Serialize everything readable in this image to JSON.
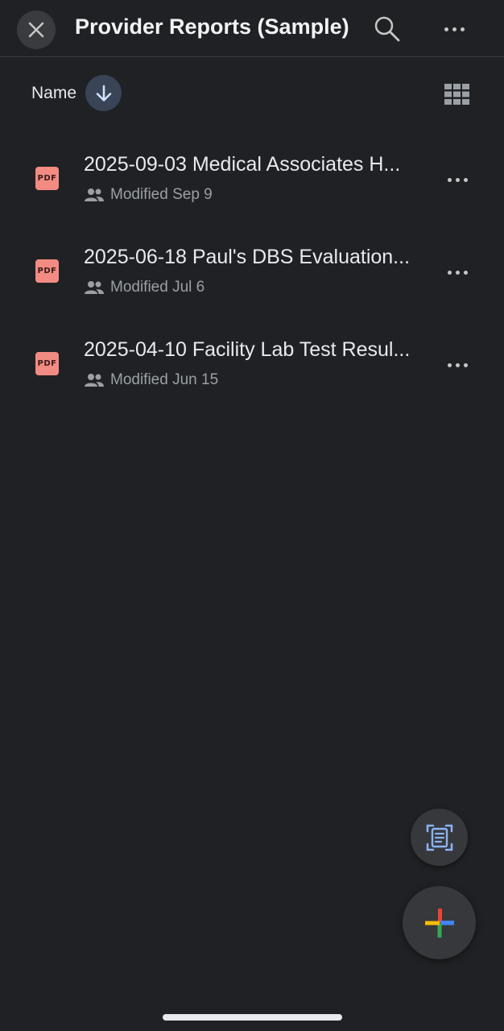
{
  "header": {
    "title": "Provider Reports (Sample)",
    "close_icon": "close-icon",
    "search_icon": "search-icon",
    "more_icon": "more-horizontal-icon"
  },
  "sort": {
    "label": "Name",
    "direction_icon": "arrow-down-icon",
    "view_icon": "grid-view-icon"
  },
  "files": [
    {
      "name": "2025-09-03 Medical Associates H...",
      "modified": "Modified Sep 9",
      "type_label": "PDF",
      "shared_icon": "people-icon"
    },
    {
      "name": "2025-06-18 Paul's DBS Evaluation...",
      "modified": "Modified Jul 6",
      "type_label": "PDF",
      "shared_icon": "people-icon"
    },
    {
      "name": "2025-04-10 Facility Lab Test Resul...",
      "modified": "Modified Jun 15",
      "type_label": "PDF",
      "shared_icon": "people-icon"
    }
  ],
  "fabs": {
    "scan_icon": "document-scan-icon",
    "add_icon": "plus-icon"
  },
  "colors": {
    "background": "#202124",
    "pdf_icon": "#f28b82",
    "sort_button": "#394457",
    "google_blue": "#4285f4",
    "google_red": "#ea4335",
    "google_yellow": "#fbbc04",
    "google_green": "#34a853"
  }
}
